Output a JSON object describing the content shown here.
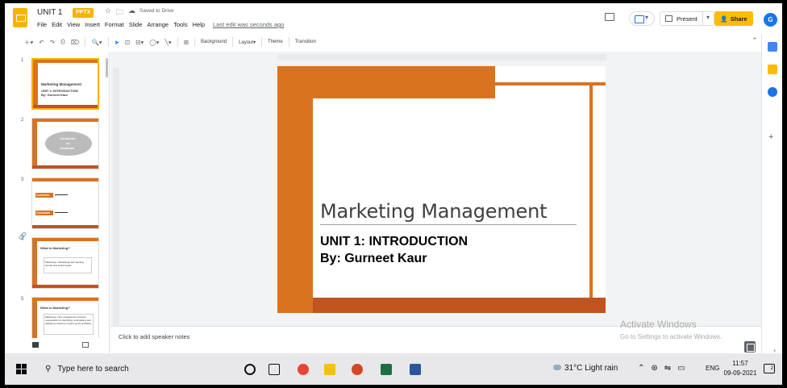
{
  "header": {
    "doc_title": "UNIT 1",
    "file_badge": "PPTX",
    "saved_status": "Saved to Drive",
    "menu": [
      "File",
      "Edit",
      "View",
      "Insert",
      "Format",
      "Slide",
      "Arrange",
      "Tools",
      "Help"
    ],
    "last_edit": "Last edit was seconds ago",
    "present_label": "Present",
    "share_label": "Share",
    "avatar_initial": "G"
  },
  "toolbar": {
    "background_label": "Background",
    "layout_label": "Layout",
    "theme_label": "Theme",
    "transition_label": "Transition"
  },
  "filmstrip": {
    "slides": [
      {
        "number": "1",
        "lines": [
          "Marketing Management",
          "UNIT 1: INTRODUCTION",
          "By: Gurneet Kaur"
        ]
      },
      {
        "number": "2",
        "lines": [
          "Consumer",
          "vs",
          "Customer"
        ]
      },
      {
        "number": "3",
        "lines": [
          "Customer",
          "Consumer"
        ]
      },
      {
        "number": "4",
        "lines": [
          "What is Marketing?",
          "Marketing = Identifying and meeting human and social needs"
        ]
      },
      {
        "number": "5",
        "lines": [
          "What is Marketing?",
          "Marketing = the management process responsible for identifying, anticipating and satisfying customer requirements profitably"
        ]
      }
    ]
  },
  "slide": {
    "title": "Marketing Management",
    "subtitle_line1": "UNIT 1: INTRODUCTION",
    "subtitle_line2": "By: Gurneet Kaur"
  },
  "notes": {
    "placeholder": "Click to add speaker notes"
  },
  "watermark": {
    "title": "Activate Windows",
    "subtitle": "Go to Settings to activate Windows."
  },
  "taskbar": {
    "search_placeholder": "Type here to search",
    "weather": "31°C  Light rain",
    "language": "ENG",
    "time": "11:57",
    "date": "09-09-2021",
    "notification_count": "2"
  },
  "colors": {
    "accent_orange": "#d9731f",
    "accent_dark": "#c0541f",
    "share_yellow": "#fbbc04",
    "avatar_blue": "#1a73e8"
  },
  "icons": [
    "docs-slides-logo",
    "star-icon",
    "move-to-folder-icon",
    "cloud-saved-icon",
    "comments-icon",
    "meet-icon",
    "present-icon",
    "share-lock-icon",
    "windows-start-icon",
    "search-icon"
  ]
}
